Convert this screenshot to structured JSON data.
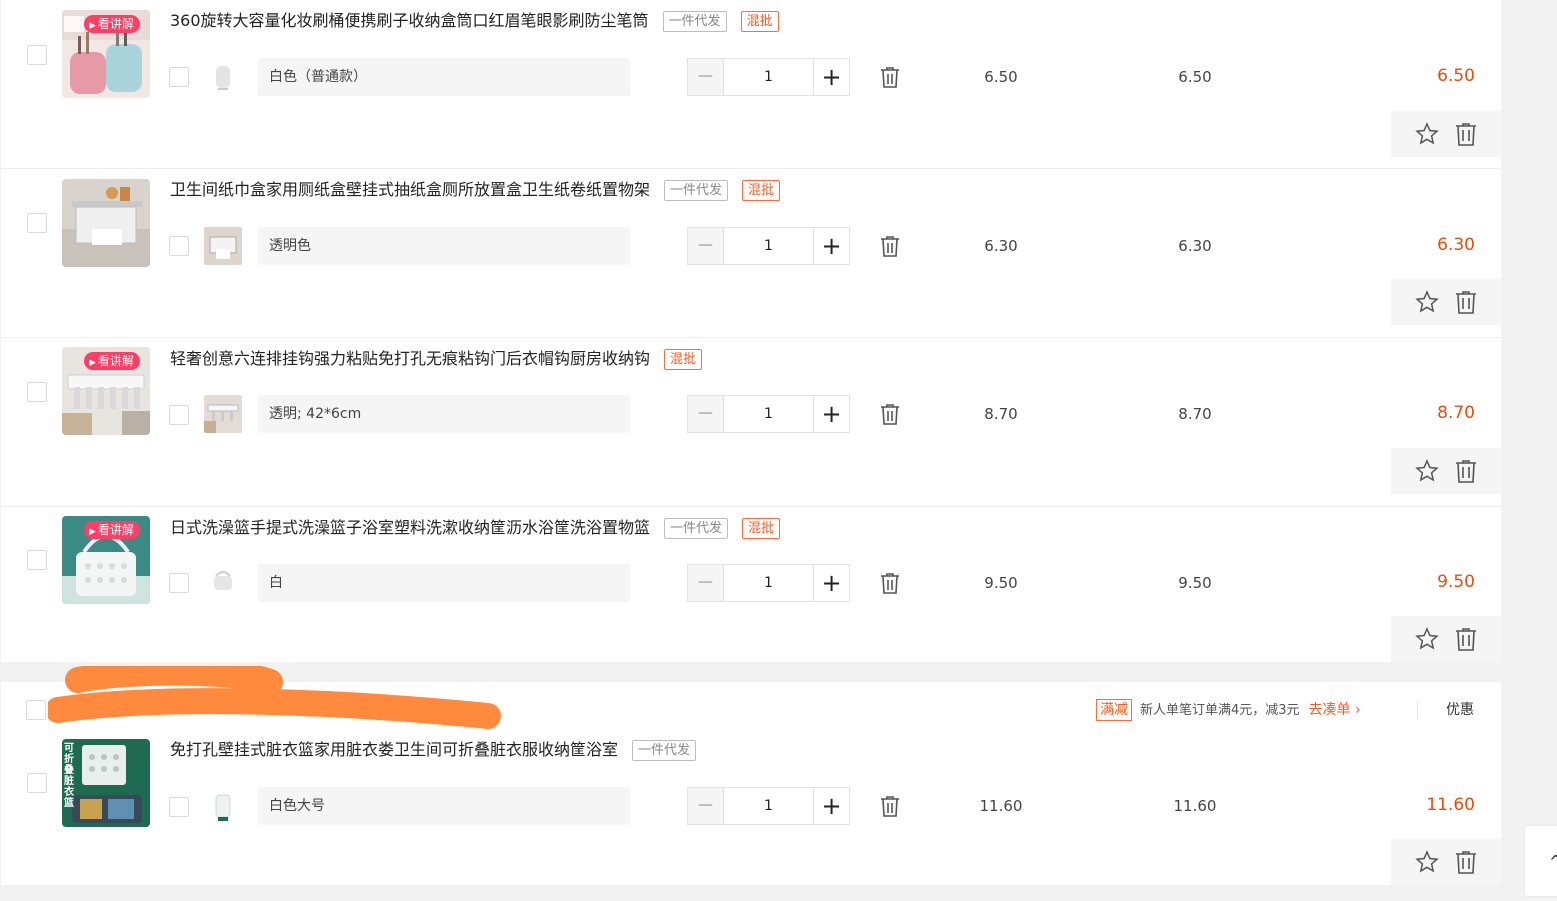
{
  "items": [
    {
      "title": "360旋转大容量化妆刷桶便携刷子收纳盒筒口红眉笔眼影刷防尘笔筒",
      "tags": [
        "一件代发",
        "混批"
      ],
      "badge": "看讲解",
      "spec": "白色（普通款）",
      "qty": "1",
      "unit_price": "6.50",
      "subtotal": "6.50",
      "total": "6.50"
    },
    {
      "title": "卫生间纸巾盒家用厕纸盒壁挂式抽纸盒厕所放置盒卫生纸卷纸置物架",
      "tags": [
        "一件代发",
        "混批"
      ],
      "badge": "",
      "spec": "透明色",
      "qty": "1",
      "unit_price": "6.30",
      "subtotal": "6.30",
      "total": "6.30"
    },
    {
      "title": "轻奢创意六连排挂钩强力粘贴免打孔无痕粘钩门后衣帽钩厨房收纳钩",
      "tags": [
        "混批"
      ],
      "badge": "看讲解",
      "spec": "透明; 42*6cm",
      "qty": "1",
      "unit_price": "8.70",
      "subtotal": "8.70",
      "total": "8.70"
    },
    {
      "title": "日式洗澡篮手提式洗澡篮子浴室塑料洗漱收纳筐沥水浴筐洗浴置物篮",
      "tags": [
        "一件代发",
        "混批"
      ],
      "badge": "看讲解",
      "spec": "白",
      "qty": "1",
      "unit_price": "9.50",
      "subtotal": "9.50",
      "total": "9.50"
    },
    {
      "title": "免打孔壁挂式脏衣篮家用脏衣娄卫生间可折叠脏衣服收纳筐浴室",
      "tags": [
        "一件代发"
      ],
      "badge": "",
      "thumb_text": "可折叠脏衣篮",
      "spec": "白色大号",
      "qty": "1",
      "unit_price": "11.60",
      "subtotal": "11.60",
      "total": "11.60"
    }
  ],
  "stepper": {
    "minus": "−",
    "plus": "+"
  },
  "promo": {
    "tag": "满减",
    "text": "新人单笔订单满4元，减3元",
    "link": "去凑单 ›",
    "coupon": "优惠"
  },
  "float_button": "^",
  "icons": [
    "trash-icon",
    "star-icon",
    "delete-icon",
    "chevron-up-icon"
  ],
  "colors": {
    "accent": "#ff5a1f",
    "price_total": "#e84d0e",
    "badge": "#ff3e66",
    "redaction": "#ff8a3d"
  }
}
